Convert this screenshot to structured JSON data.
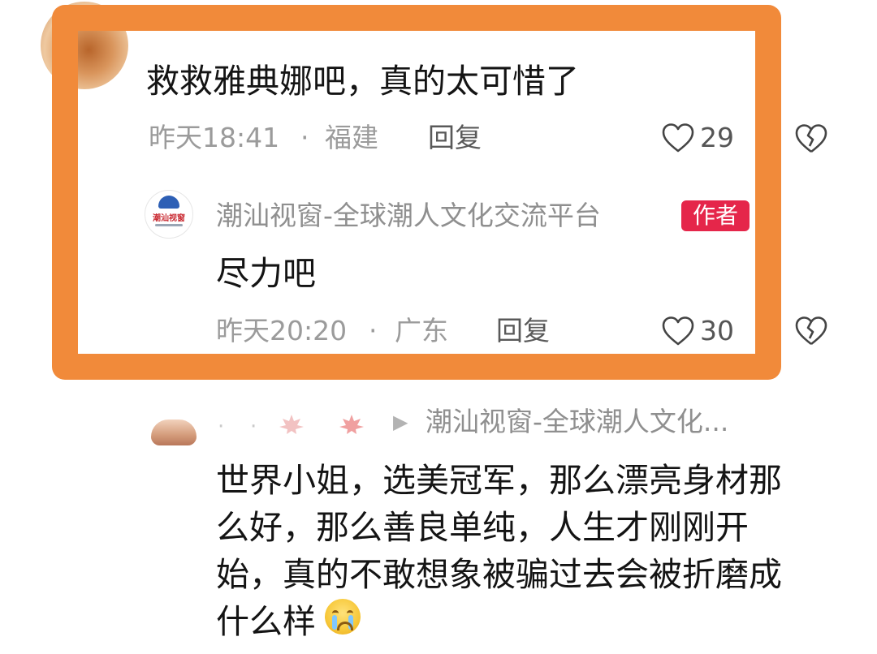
{
  "comment1": {
    "user_name": "",
    "text": "救救雅典娜吧，真的太可惜了",
    "time": "昨天18:41",
    "location": "福建",
    "separator": "·",
    "reply_label": "回复",
    "likes": "29"
  },
  "reply1": {
    "user_name": "潮汕视窗-全球潮人文化交流平台",
    "badge": "作者",
    "avatar_logo_text": "潮汕视窗",
    "text": "尽力吧",
    "time": "昨天20:20",
    "location": "广东",
    "separator": "·",
    "reply_label": "回复",
    "likes": "30"
  },
  "reply2": {
    "reply_to_arrow": "▶",
    "reply_to": "潮汕视窗-全球潮人文化...",
    "text_lines": [
      "世界小姐，选美冠军，那么漂亮身材那",
      "么好，那么善良单纯，人生才刚刚开",
      "始，真的不敢想象被骗过去会被折磨成",
      "什么样"
    ],
    "emoji": "crying-face"
  },
  "colors": {
    "highlight": "#f18a3a",
    "badge": "#e5264a",
    "meta_text": "#9b9b9b"
  }
}
